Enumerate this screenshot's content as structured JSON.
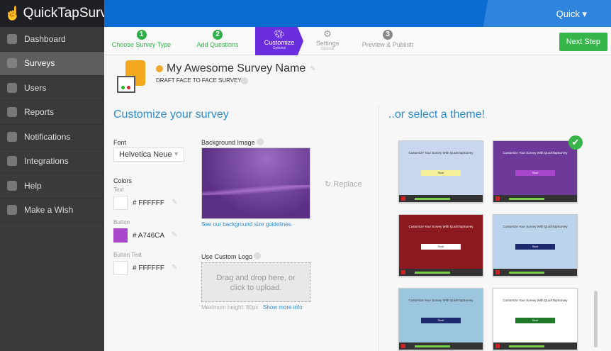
{
  "app": {
    "logo": "QuickTapSurvey",
    "account_menu": "Quick ▾"
  },
  "sidebar": {
    "items": [
      {
        "label": "Dashboard"
      },
      {
        "label": "Surveys"
      },
      {
        "label": "Users"
      },
      {
        "label": "Reports"
      },
      {
        "label": "Notifications"
      },
      {
        "label": "Integrations"
      },
      {
        "label": "Help"
      },
      {
        "label": "Make a Wish"
      }
    ]
  },
  "steps": [
    {
      "num": "1",
      "label": "Choose Survey Type"
    },
    {
      "num": "2",
      "label": "Add Questions"
    },
    {
      "label": "Customize",
      "sub": "Optional"
    },
    {
      "label": "Settings",
      "sub": "Optional"
    },
    {
      "num": "3",
      "label": "Preview & Publish"
    }
  ],
  "next_step": "Next Step",
  "survey": {
    "name": "My Awesome Survey Name",
    "type": "DRAFT FACE TO FACE SURVEY"
  },
  "customize": {
    "title": "Customize your survey",
    "font_label": "Font",
    "font_value": "Helvetica Neue",
    "colors_label": "Colors",
    "text_label": "Text",
    "text_hex": "# FFFFFF",
    "button_label": "Button",
    "button_hex": "# A746CA",
    "button_text_label": "Button Text",
    "button_text_hex": "# FFFFFF",
    "bg_label": "Background Image",
    "bg_link": "See our background size guidelines.",
    "replace": "Replace",
    "logo_label": "Use Custom Logo",
    "drop_text": "Drag and drop here, or click to upload.",
    "max_height": "Maximum height: 80px",
    "more_info": "Show more info"
  },
  "themes": {
    "title": "..or select a theme!",
    "card_title": "Customize Your Survey With QuickTapSurvey",
    "start": "Start",
    "items": [
      {
        "bg": "#c9d6ef",
        "btn": "#f4f09a",
        "fg": "#333"
      },
      {
        "bg": "#6d3a9a",
        "btn": "#a746ca",
        "fg": "#fff",
        "selected": true
      },
      {
        "bg": "#8a1a1f",
        "btn": "#ffffff",
        "fg": "#fff"
      },
      {
        "bg": "#bcd3ec",
        "btn": "#1e2a6e",
        "fg": "#333"
      },
      {
        "bg": "#9cc5de",
        "btn": "#1e2a6e",
        "fg": "#333"
      },
      {
        "bg": "#ffffff",
        "btn": "#1f7a2a",
        "fg": "#333"
      }
    ]
  },
  "colors": {
    "accent": "#6a2de0",
    "primary": "#0a6bd0",
    "success": "#38b54a"
  }
}
